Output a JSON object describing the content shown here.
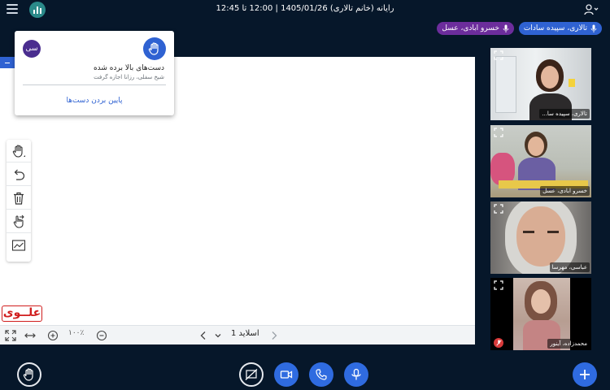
{
  "header": {
    "title": "رایانه (خانم تالاری) 1405/01/26 | 12:00 تا 12:45"
  },
  "talking": [
    {
      "name": "تالاری، سپیده سادات",
      "color": "#2f62d2"
    },
    {
      "name": "خسرو ابادی، عسل",
      "color": "#6c2d9c"
    }
  ],
  "notification": {
    "avatar_initials": "سی",
    "title": "دست‌های بالا برده شده",
    "subtitle": "شیخ سفلی، رزانا اجازه گرفت",
    "action": "پایین بردن دست‌ها"
  },
  "whiteboard": {
    "watermark": "علــوی",
    "zoom_percent": "۱۰۰٪",
    "slide_label": "اسلاید 1"
  },
  "participants": [
    {
      "name": "تالاری، سپیده سا...",
      "muted": false,
      "active": true
    },
    {
      "name": "خسرو ابادی، عسل",
      "muted": false,
      "active": true
    },
    {
      "name": "عباسی، مهرسا",
      "muted": false,
      "active": false
    },
    {
      "name": "محمدزاده، آینور",
      "muted": true,
      "active": false
    }
  ],
  "icons": {
    "logo": "bar-chart-icon",
    "menu": "hamburger-icon",
    "user": "user-settings-icon",
    "mic": "microphone-icon",
    "hand": "raise-hand-icon",
    "camera": "camera-icon",
    "phone": "phone-hangup-icon",
    "screen_share": "screen-share-off-icon",
    "plus": "plus-icon"
  },
  "colors": {
    "background": "#06172a",
    "accent": "#2f6be0",
    "purple": "#6c2d9c",
    "watermark": "#d01e1e"
  }
}
